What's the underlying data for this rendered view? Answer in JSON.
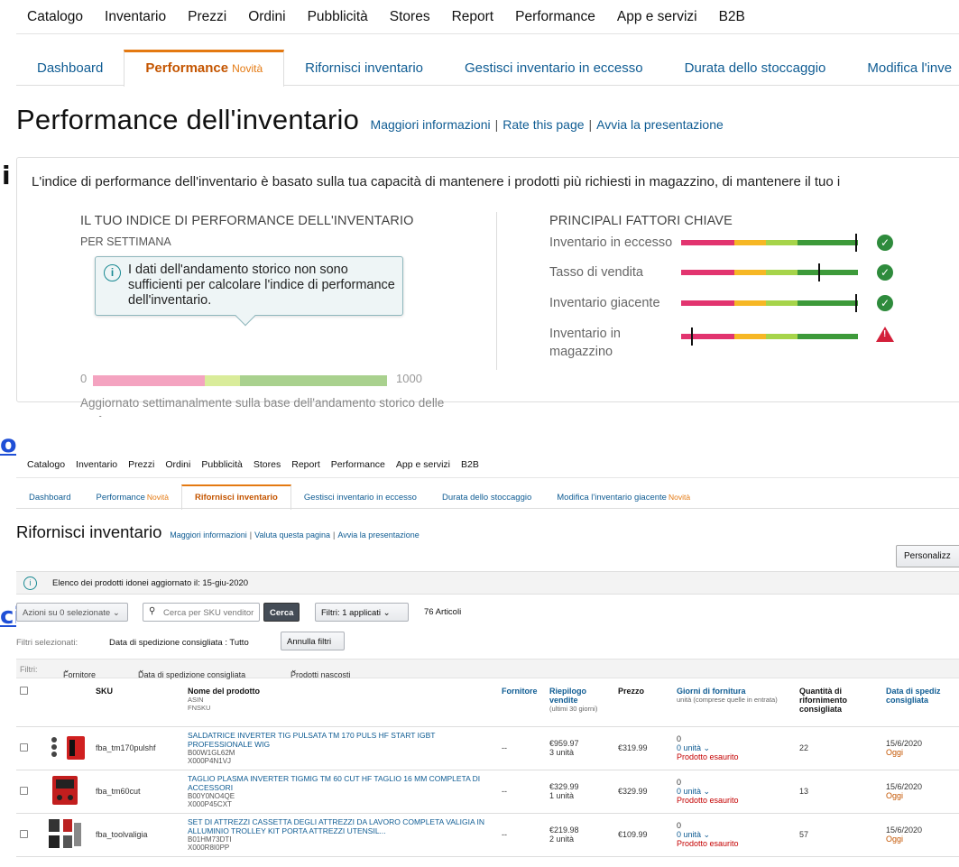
{
  "fragments": {
    "letter": "i",
    "underlined_o": "o",
    "underlined_ci": "ci"
  },
  "top": {
    "nav": [
      "Catalogo",
      "Inventario",
      "Prezzi",
      "Ordini",
      "Pubblicità",
      "Stores",
      "Report",
      "Performance",
      "App e servizi",
      "B2B"
    ],
    "tabs": [
      {
        "label": "Dashboard",
        "new": ""
      },
      {
        "label": "Performance",
        "new": "Novità"
      },
      {
        "label": "Rifornisci inventario",
        "new": ""
      },
      {
        "label": "Gestisci inventario in eccesso",
        "new": ""
      },
      {
        "label": "Durata dello stoccaggio",
        "new": ""
      },
      {
        "label": "Modifica l'inve",
        "new": ""
      }
    ],
    "title": "Performance dell'inventario",
    "links": [
      "Maggiori informazioni",
      "Rate this page",
      "Avvia la presentazione"
    ],
    "description": "L'indice di performance dell'inventario è basato sulla tua capacità di mantenere i prodotti più richiesti in magazzino, di mantenere il tuo i",
    "index_heading": "IL TUO INDICE DI PERFORMANCE DELL'INVENTARIO",
    "index_sub": "PER SETTIMANA",
    "tooltip": "I dati dell'andamento storico non sono sufficienti per calcolare l'indice di performance dell'inventario.",
    "scale_min": "0",
    "scale_max": "1000",
    "updated_note": "Aggiornato settimanalmente sulla base dell'andamento storico delle performance",
    "factors_heading": "PRINCIPALI FATTORI CHIAVE",
    "factors": [
      {
        "label": "Inventario in eccesso",
        "marker": 0.99,
        "status": "ok"
      },
      {
        "label": "Tasso di vendita",
        "marker": 0.78,
        "status": "ok"
      },
      {
        "label": "Inventario giacente",
        "marker": 0.99,
        "status": "ok"
      },
      {
        "label": "Inventario in magazzino",
        "marker": 0.06,
        "status": "warning"
      }
    ],
    "colors": {
      "pink": "#f4a3c0",
      "lightgreen": "#d9ec9a",
      "green": "#a9d18e",
      "red": "#e2346f",
      "orange": "#f6b725",
      "lime": "#a6d44a",
      "darkgreen": "#3d9a3a"
    }
  },
  "bottom": {
    "nav": [
      "Catalogo",
      "Inventario",
      "Prezzi",
      "Ordini",
      "Pubblicità",
      "Stores",
      "Report",
      "Performance",
      "App e servizi",
      "B2B"
    ],
    "tabs": [
      {
        "label": "Dashboard",
        "new": ""
      },
      {
        "label": "Performance",
        "new": "Novità"
      },
      {
        "label": "Rifornisci inventario",
        "new": ""
      },
      {
        "label": "Gestisci inventario in eccesso",
        "new": ""
      },
      {
        "label": "Durata dello stoccaggio",
        "new": ""
      },
      {
        "label": "Modifica l'inventario giacente",
        "new": "Novità"
      }
    ],
    "title": "Rifornisci inventario",
    "links": [
      "Maggiori informazioni",
      "Valuta questa pagina",
      "Avvia la presentazione"
    ],
    "personalize": "Personalizz",
    "info_text": "Elenco dei prodotti idonei aggiornato il: 15-giu-2020",
    "actions_select": "Azioni su 0 selezionate",
    "search_placeholder": "Cerca per SKU venditor",
    "search_button": "Cerca",
    "filters_select": "Filtri: 1 applicati",
    "article_count": "76 Articoli",
    "selected_filters_label": "Filtri selezionati:",
    "selected_filter": "Data di spedizione consigliata : Tutto",
    "clear_filters": "Annulla filtri",
    "filter_bar": {
      "label": "Filtri:",
      "items": [
        "Fornitore",
        "Data di spedizione consigliata",
        "Prodotti nascosti"
      ]
    },
    "columns": {
      "sku": "SKU",
      "name": "Nome del prodotto",
      "name_sub1": "ASIN",
      "name_sub2": "FNSKU",
      "supplier": "Fornitore",
      "sales": "Riepilogo vendite",
      "sales_sub": "(ultimi 30 giorni)",
      "price": "Prezzo",
      "supply_days": "Giorni di fornitura",
      "supply_sub": "unità (comprese quelle in entrata)",
      "qty": "Quantità di rifornimento consigliata",
      "ship_date": "Data di spediz consigliata"
    },
    "rows": [
      {
        "sku": "fba_tm170pulshf",
        "name": "SALDATRICE INVERTER TIG PULSATA TM 170 PULS HF START IGBT PROFESSIONALE WIG",
        "asin": "B00W1GL62M",
        "fnsku": "X000P4N1VJ",
        "supplier": "--",
        "sales": "€959.97",
        "units": "3 unità",
        "price": "€319.99",
        "supply": "0",
        "supply_units": "0 unità",
        "status": "Prodotto esaurito",
        "qty": "22",
        "date": "15/6/2020",
        "today": "Oggi"
      },
      {
        "sku": "fba_tm60cut",
        "name": "TAGLIO PLASMA INVERTER TIGMIG TM 60 CUT HF TAGLIO 16 MM COMPLETA DI ACCESSORI",
        "asin": "B00Y0NO4QE",
        "fnsku": "X000P45CXT",
        "supplier": "--",
        "sales": "€329.99",
        "units": "1 unità",
        "price": "€329.99",
        "supply": "0",
        "supply_units": "0 unità",
        "status": "Prodotto esaurito",
        "qty": "13",
        "date": "15/6/2020",
        "today": "Oggi"
      },
      {
        "sku": "fba_toolvaligia",
        "name": "SET DI ATTREZZI CASSETTA DEGLI ATTREZZI DA LAVORO COMPLETA VALIGIA IN ALLUMINIO TROLLEY KIT PORTA ATTREZZI UTENSIL...",
        "asin": "B01HM73DTI",
        "fnsku": "X000R8I0PP",
        "supplier": "--",
        "sales": "€219.98",
        "units": "2 unità",
        "price": "€109.99",
        "supply": "0",
        "supply_units": "0 unità",
        "status": "Prodotto esaurito",
        "qty": "57",
        "date": "15/6/2020",
        "today": "Oggi"
      }
    ]
  }
}
